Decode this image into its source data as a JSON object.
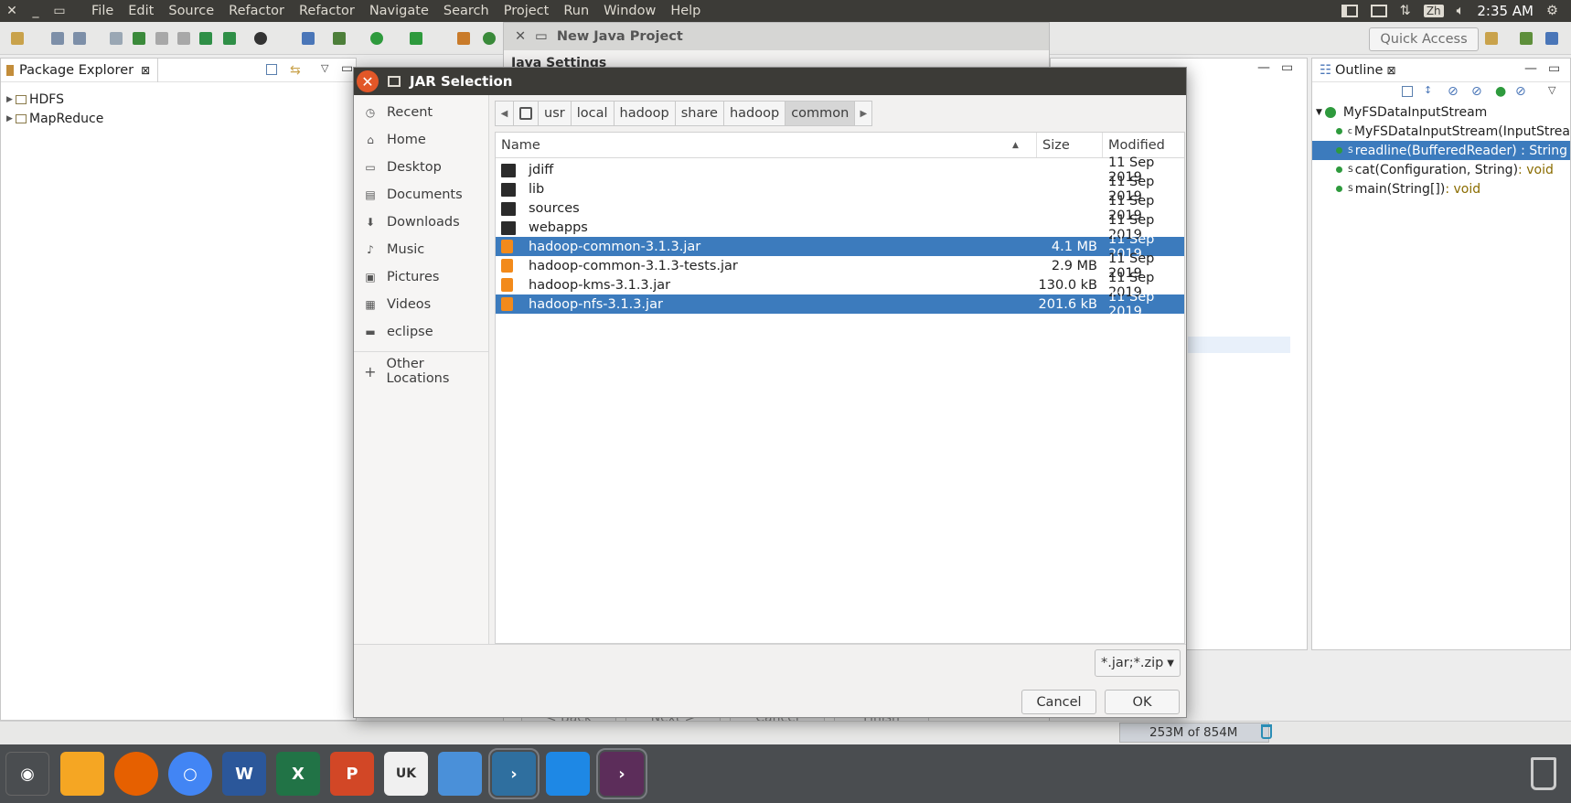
{
  "menubar": {
    "items": [
      "File",
      "Edit",
      "Source",
      "Refactor",
      "Refactor",
      "Navigate",
      "Search",
      "Project",
      "Run",
      "Window",
      "Help"
    ],
    "ime": "Zh",
    "clock": "2:35 AM"
  },
  "toolbar": {
    "quick_access": "Quick Access"
  },
  "package_explorer": {
    "title": "Package Explorer",
    "projects": [
      "HDFS",
      "MapReduce"
    ]
  },
  "outline": {
    "title": "Outline",
    "class_name": "MyFSDataInputStream",
    "members": [
      {
        "sup": "c",
        "name": "MyFSDataInputStream(InputStrea",
        "ret": ""
      },
      {
        "sup": "S",
        "name": "readline(BufferedReader) : String",
        "ret": ""
      },
      {
        "sup": "S",
        "name": "cat(Configuration, String)",
        "ret": " : void"
      },
      {
        "sup": "S",
        "name": "main(String[])",
        "ret": " : void"
      }
    ]
  },
  "wizard": {
    "title": "New Java Project",
    "section": "Java Settings",
    "buttons": [
      "< Back",
      "Next >",
      "Cancel",
      "Finish"
    ]
  },
  "heap": "253M of 854M",
  "dialog": {
    "title": "JAR Selection",
    "places": [
      "Recent",
      "Home",
      "Desktop",
      "Documents",
      "Downloads",
      "Music",
      "Pictures",
      "Videos",
      "eclipse"
    ],
    "other_locations": "Other Locations",
    "path": [
      "usr",
      "local",
      "hadoop",
      "share",
      "hadoop",
      "common"
    ],
    "columns": {
      "name": "Name",
      "size": "Size",
      "modified": "Modified"
    },
    "files": [
      {
        "name": "jdiff",
        "type": "folder",
        "size": "",
        "modified": "11 Sep 2019",
        "selected": false
      },
      {
        "name": "lib",
        "type": "folder",
        "size": "",
        "modified": "11 Sep 2019",
        "selected": false
      },
      {
        "name": "sources",
        "type": "folder",
        "size": "",
        "modified": "11 Sep 2019",
        "selected": false
      },
      {
        "name": "webapps",
        "type": "folder",
        "size": "",
        "modified": "11 Sep 2019",
        "selected": false
      },
      {
        "name": "hadoop-common-3.1.3.jar",
        "type": "jar",
        "size": "4.1 MB",
        "modified": "11 Sep 2019",
        "selected": true
      },
      {
        "name": "hadoop-common-3.1.3-tests.jar",
        "type": "jar",
        "size": "2.9 MB",
        "modified": "11 Sep 2019",
        "selected": false
      },
      {
        "name": "hadoop-kms-3.1.3.jar",
        "type": "jar",
        "size": "130.0 kB",
        "modified": "11 Sep 2019",
        "selected": false
      },
      {
        "name": "hadoop-nfs-3.1.3.jar",
        "type": "jar",
        "size": "201.6 kB",
        "modified": "11 Sep 2019",
        "selected": true
      }
    ],
    "filter": "*.jar;*.zip",
    "cancel": "Cancel",
    "ok": "OK"
  },
  "dock": {
    "colors": [
      "#e95420",
      "#f5a623",
      "#e66000",
      "#4285f4",
      "#2b579a",
      "#217346",
      "#d24726",
      "#f0f0f0",
      "#4a90d9",
      "#2f6f9f",
      "#1e88e5",
      "#5c2d5a"
    ]
  }
}
